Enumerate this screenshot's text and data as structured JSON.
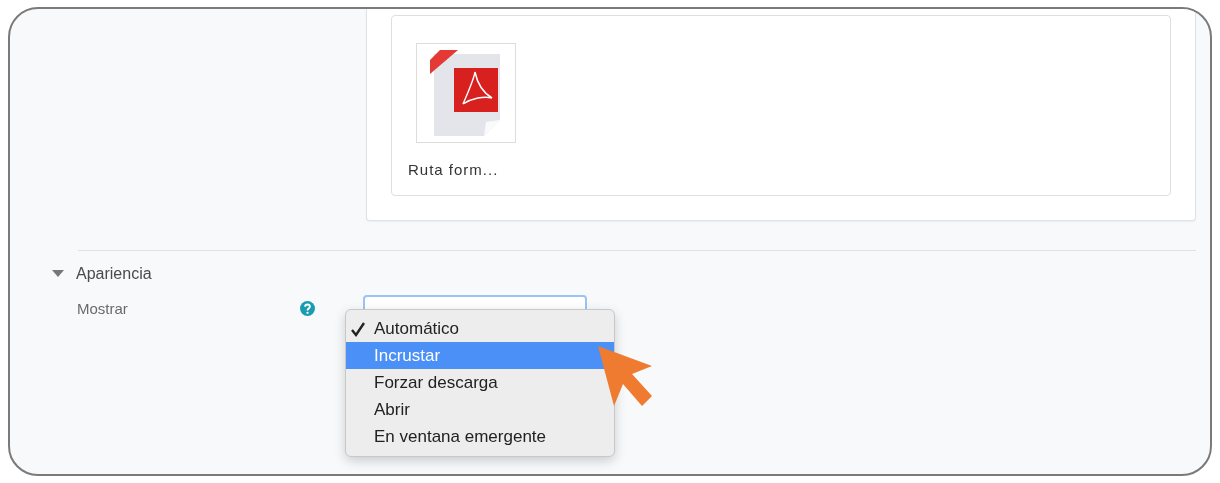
{
  "file": {
    "name": "Ruta form..."
  },
  "section": {
    "title": "Apariencia",
    "expanded": true
  },
  "field": {
    "label": "Mostrar"
  },
  "menu": {
    "options": [
      {
        "label": "Automático",
        "checked": true,
        "selected": false
      },
      {
        "label": "Incrustar",
        "checked": false,
        "selected": true
      },
      {
        "label": "Forzar descarga",
        "checked": false,
        "selected": false
      },
      {
        "label": "Abrir",
        "checked": false,
        "selected": false
      },
      {
        "label": "En ventana emergente",
        "checked": false,
        "selected": false
      }
    ]
  }
}
